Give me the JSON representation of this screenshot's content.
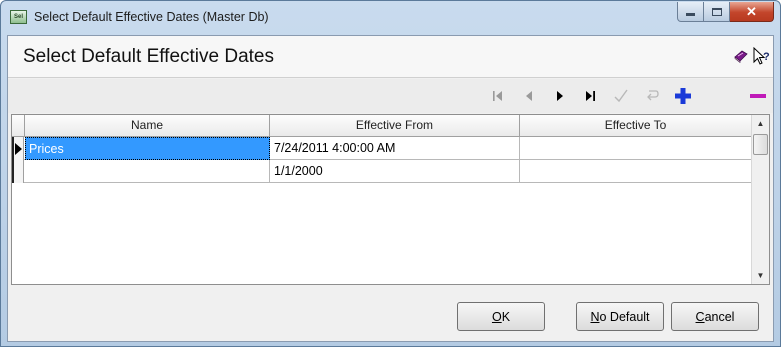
{
  "window": {
    "title": "Select Default Effective Dates (Master Db)",
    "app_icon_text": "Sel",
    "close_glyph": "✕"
  },
  "dialog": {
    "heading": "Select Default Effective Dates"
  },
  "toolbar": {
    "buttons": [
      {
        "name": "first-record",
        "icon": "first-icon",
        "enabled": false
      },
      {
        "name": "prev-record",
        "icon": "prev-icon",
        "enabled": false
      },
      {
        "name": "next-record",
        "icon": "next-icon",
        "enabled": true
      },
      {
        "name": "last-record",
        "icon": "last-icon",
        "enabled": true
      },
      {
        "name": "post-edit",
        "icon": "checkmark-icon",
        "enabled": false
      },
      {
        "name": "cancel-edit",
        "icon": "undo-icon",
        "enabled": false
      },
      {
        "name": "insert-record",
        "icon": "plus-icon",
        "enabled": true,
        "color": "#1a3ad8"
      },
      {
        "name": "delete-record",
        "icon": "minus-icon",
        "enabled": true,
        "color": "#c01ab8"
      }
    ]
  },
  "grid": {
    "columns": [
      "Name",
      "Effective From",
      "Effective To"
    ],
    "rows": [
      {
        "name": "Prices",
        "from": "7/24/2011 4:00:00 AM",
        "to": "",
        "current": true
      },
      {
        "name": "",
        "from": "1/1/2000",
        "to": "",
        "current": false
      }
    ],
    "selection_color": "#3399ff"
  },
  "buttons": {
    "ok": {
      "hotkey": "O",
      "rest": "K"
    },
    "no_default": {
      "hotkey": "N",
      "rest": "o Default"
    },
    "cancel": {
      "hotkey": "C",
      "rest": "ancel"
    }
  }
}
